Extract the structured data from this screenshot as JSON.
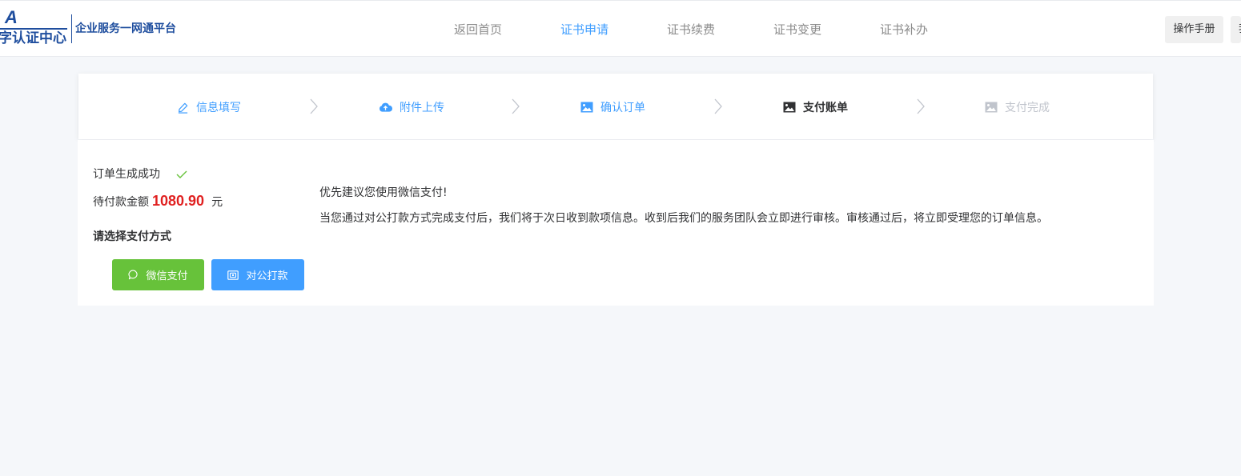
{
  "header": {
    "logo_mark": "A",
    "logo_text": "字认证中心",
    "platform_name": "企业服务一网通平台",
    "nav": [
      {
        "label": "返回首页"
      },
      {
        "label": "证书申请"
      },
      {
        "label": "证书续费"
      },
      {
        "label": "证书变更"
      },
      {
        "label": "证书补办"
      }
    ],
    "active_nav_index": 1,
    "buttons": [
      {
        "label": "操作手册"
      },
      {
        "label": "我"
      }
    ]
  },
  "steps": [
    {
      "label": "信息填写",
      "icon": "edit-icon",
      "state": "done"
    },
    {
      "label": "附件上传",
      "icon": "cloud-upload-icon",
      "state": "done"
    },
    {
      "label": "确认订单",
      "icon": "picture-icon",
      "state": "done"
    },
    {
      "label": "支付账单",
      "icon": "picture-icon",
      "state": "current"
    },
    {
      "label": "支付完成",
      "icon": "picture-icon",
      "state": "todo"
    }
  ],
  "order": {
    "status": "订单生成成功",
    "amount_label": "待付款金额",
    "amount": "1080.90",
    "unit": "元",
    "choose_label": "请选择支付方式",
    "wechat_btn": "微信支付",
    "transfer_btn": "对公打款",
    "tip1": "优先建议您使用微信支付!",
    "tip2": "当您通过对公打款方式完成支付后，我们将于次日收到款项信息。收到后我们的服务团队会立即进行审核。审核通过后，将立即受理您的订单信息。"
  },
  "colors": {
    "primary": "#409eff",
    "success": "#67c23a",
    "danger": "#e02020",
    "brand": "#1f4e9e"
  }
}
